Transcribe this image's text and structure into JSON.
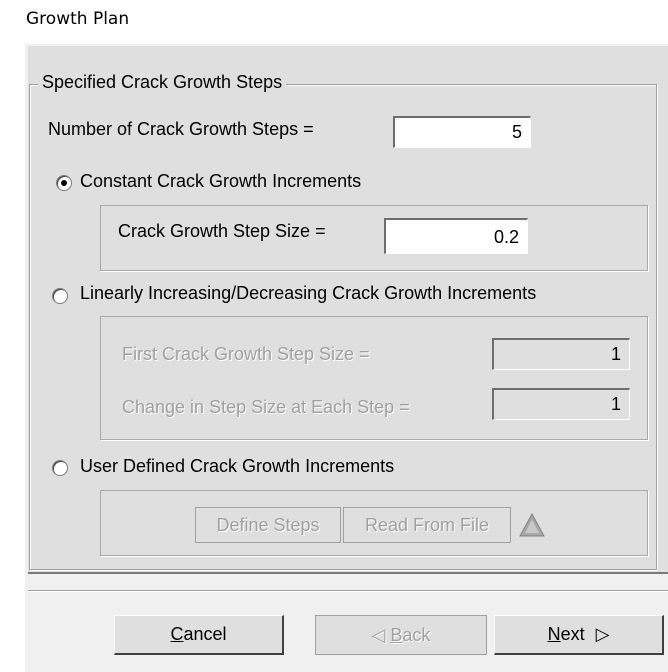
{
  "window": {
    "title": "Growth Plan"
  },
  "group": {
    "legend": "Specified Crack Growth Steps"
  },
  "steps": {
    "label": "Number of Crack Growth Steps =",
    "value": "5"
  },
  "constant": {
    "label": "Constant Crack Growth Increments",
    "selected": true,
    "step_size_label": "Crack Growth Step Size =",
    "step_size_value": "0.2"
  },
  "linear": {
    "label": "Linearly Increasing/Decreasing Crack Growth Increments",
    "selected": false,
    "first_label": "First Crack Growth Step Size =",
    "first_value": "1",
    "change_label": "Change in Step Size at Each Step =",
    "change_value": "1"
  },
  "user_defined": {
    "label": "User Defined Crack Growth Increments",
    "selected": false,
    "define_button": "Define Steps",
    "read_button": "Read From File"
  },
  "buttons": {
    "cancel_first": "C",
    "cancel_rest": "ancel",
    "back_arrow": "◁",
    "back_first": "B",
    "back_rest": "ack",
    "next_first": "N",
    "next_rest": "ext",
    "next_arrow": "▷"
  },
  "icons": {
    "warning": "warning-triangle-icon",
    "radio": "radio-icon"
  }
}
